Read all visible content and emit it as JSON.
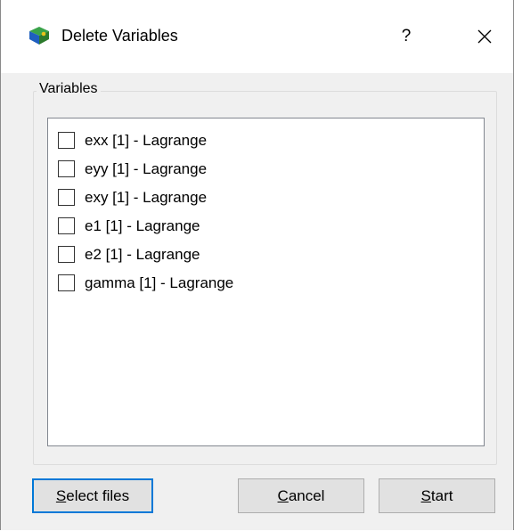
{
  "window": {
    "title": "Delete Variables",
    "help_glyph": "?",
    "icons": {
      "app": "app-cube-icon",
      "close": "close-icon"
    }
  },
  "variables_group": {
    "label": "Variables",
    "items": [
      {
        "label": "exx [1] - Lagrange",
        "checked": false
      },
      {
        "label": "eyy [1] - Lagrange",
        "checked": false
      },
      {
        "label": "exy [1] - Lagrange",
        "checked": false
      },
      {
        "label": "e1 [1] - Lagrange",
        "checked": false
      },
      {
        "label": "e2 [1] - Lagrange",
        "checked": false
      },
      {
        "label": "gamma [1] - Lagrange",
        "checked": false
      }
    ]
  },
  "buttons": {
    "select_files": {
      "mnemonic": "S",
      "rest": "elect files"
    },
    "cancel": {
      "mnemonic": "C",
      "rest": "ancel"
    },
    "start": {
      "mnemonic": "S",
      "rest": "tart"
    }
  },
  "colors": {
    "focus_border": "#0078d7",
    "dialog_bg": "#f0f0f0"
  }
}
